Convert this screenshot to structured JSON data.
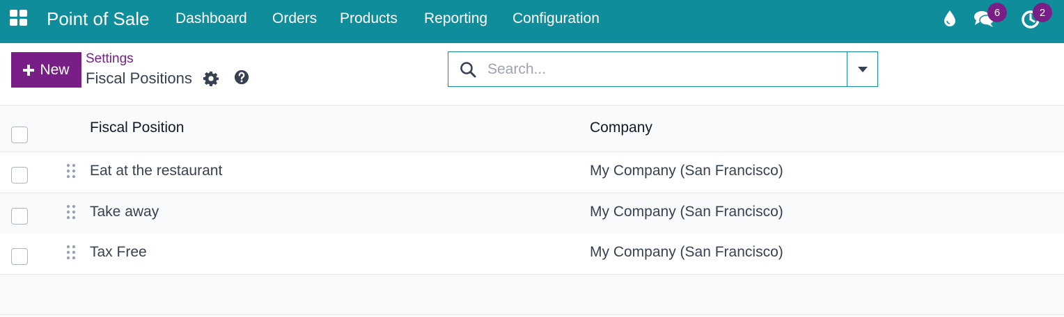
{
  "navbar": {
    "app_title": "Point of Sale",
    "menu": [
      "Dashboard",
      "Orders",
      "Products",
      "Reporting",
      "Configuration"
    ],
    "messages_count": "6",
    "activities_count": "2",
    "icons": [
      "apps-grid-icon",
      "drop-icon",
      "chat-icon",
      "clock-icon"
    ]
  },
  "control_panel": {
    "new_label": "New",
    "breadcrumb_parent": "Settings",
    "title": "Fiscal Positions",
    "search_placeholder": "Search..."
  },
  "table": {
    "columns": [
      "Fiscal Position",
      "Company"
    ],
    "rows": [
      {
        "fiscal_position": "Eat at the restaurant",
        "company": "My Company (San Francisco)"
      },
      {
        "fiscal_position": "Take away",
        "company": "My Company (San Francisco)"
      },
      {
        "fiscal_position": "Tax Free",
        "company": "My Company (San Francisco)"
      }
    ]
  },
  "colors": {
    "navbar": "#0f8d9b",
    "primary": "#7a1e87",
    "badge": "#7a1e87"
  }
}
